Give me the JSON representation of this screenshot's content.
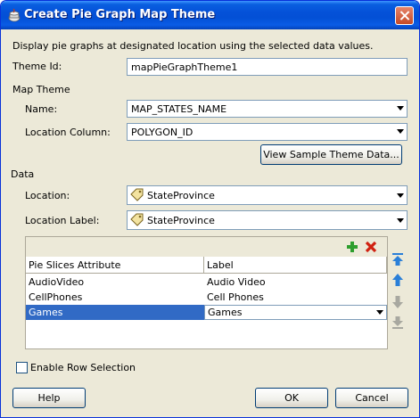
{
  "window": {
    "title": "Create Pie Graph Map Theme"
  },
  "description": "Display pie graphs at designated location using the selected data values.",
  "theme_id": {
    "label": "Theme Id:",
    "value": "mapPieGraphTheme1"
  },
  "map_theme": {
    "section_label": "Map Theme",
    "name_label": "Name:",
    "name_value": "MAP_STATES_NAME",
    "location_column_label": "Location Column:",
    "location_column_value": "POLYGON_ID",
    "view_sample_button": "View Sample Theme Data..."
  },
  "data": {
    "section_label": "Data",
    "location_label": "Location:",
    "location_value": "StateProvince",
    "location_label_label": "Location Label:",
    "location_label_value": "StateProvince"
  },
  "table": {
    "headers": [
      "Pie Slices Attribute",
      "Label"
    ],
    "rows": [
      {
        "attribute": "AudioVideo",
        "label": "Audio Video"
      },
      {
        "attribute": "CellPhones",
        "label": "Cell Phones"
      },
      {
        "attribute": "Games",
        "label": "Games"
      }
    ]
  },
  "enable_row_selection": {
    "label": "Enable Row Selection",
    "checked": false
  },
  "buttons": {
    "help": "Help",
    "ok": "OK",
    "cancel": "Cancel"
  },
  "colors": {
    "titlebar": "#0451d8",
    "selection": "#316ac5",
    "add_icon": "#2e9e2e",
    "remove_icon": "#d02010",
    "arrow_icon": "#2a7fd8"
  }
}
